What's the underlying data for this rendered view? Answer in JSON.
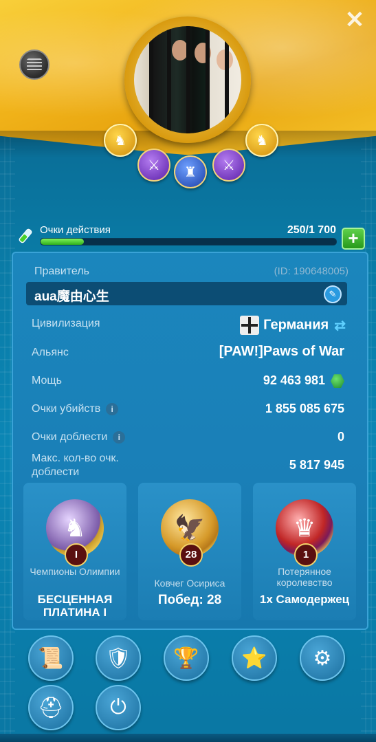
{
  "window": {
    "close_label": "✕"
  },
  "action_points": {
    "label": "Очки действия",
    "value": "250/1 700",
    "fill": 0.147,
    "plus_label": "+"
  },
  "profile": {
    "ruler_label": "Правитель",
    "id_text": "(ID: 190648005)",
    "name": "aua魔由心生",
    "civilization_label": "Цивилизация",
    "civilization_value": "Германия",
    "alliance_label": "Альянс",
    "alliance_value": "[PAW!]Paws of War",
    "power_label": "Мощь",
    "power_value": "92 463 981",
    "kill_points_label": "Очки убийств",
    "kill_points_value": "1 855 085 675",
    "valor_label": "Очки доблести",
    "valor_value": "0",
    "max_valor_label": "Макс. кол-во очк. доблести",
    "max_valor_value": "5 817 945"
  },
  "achievements": [
    {
      "title": "Чемпионы Олимпии",
      "value": "БЕСЦЕННАЯ ПЛАТИНА I",
      "badge": "I",
      "icon": "horse-icon"
    },
    {
      "title": "Ковчег Осириса",
      "value": "Побед: 28",
      "badge": "28",
      "icon": "eagle-icon"
    },
    {
      "title": "Потерянное королевство",
      "value": "1x Самодержец",
      "badge": "1",
      "icon": "shield-crown-icon"
    }
  ],
  "colors": {
    "accent_gold": "#f2b51b",
    "panel_blue": "#1a7fb7",
    "progress_green": "#2fae1c"
  }
}
